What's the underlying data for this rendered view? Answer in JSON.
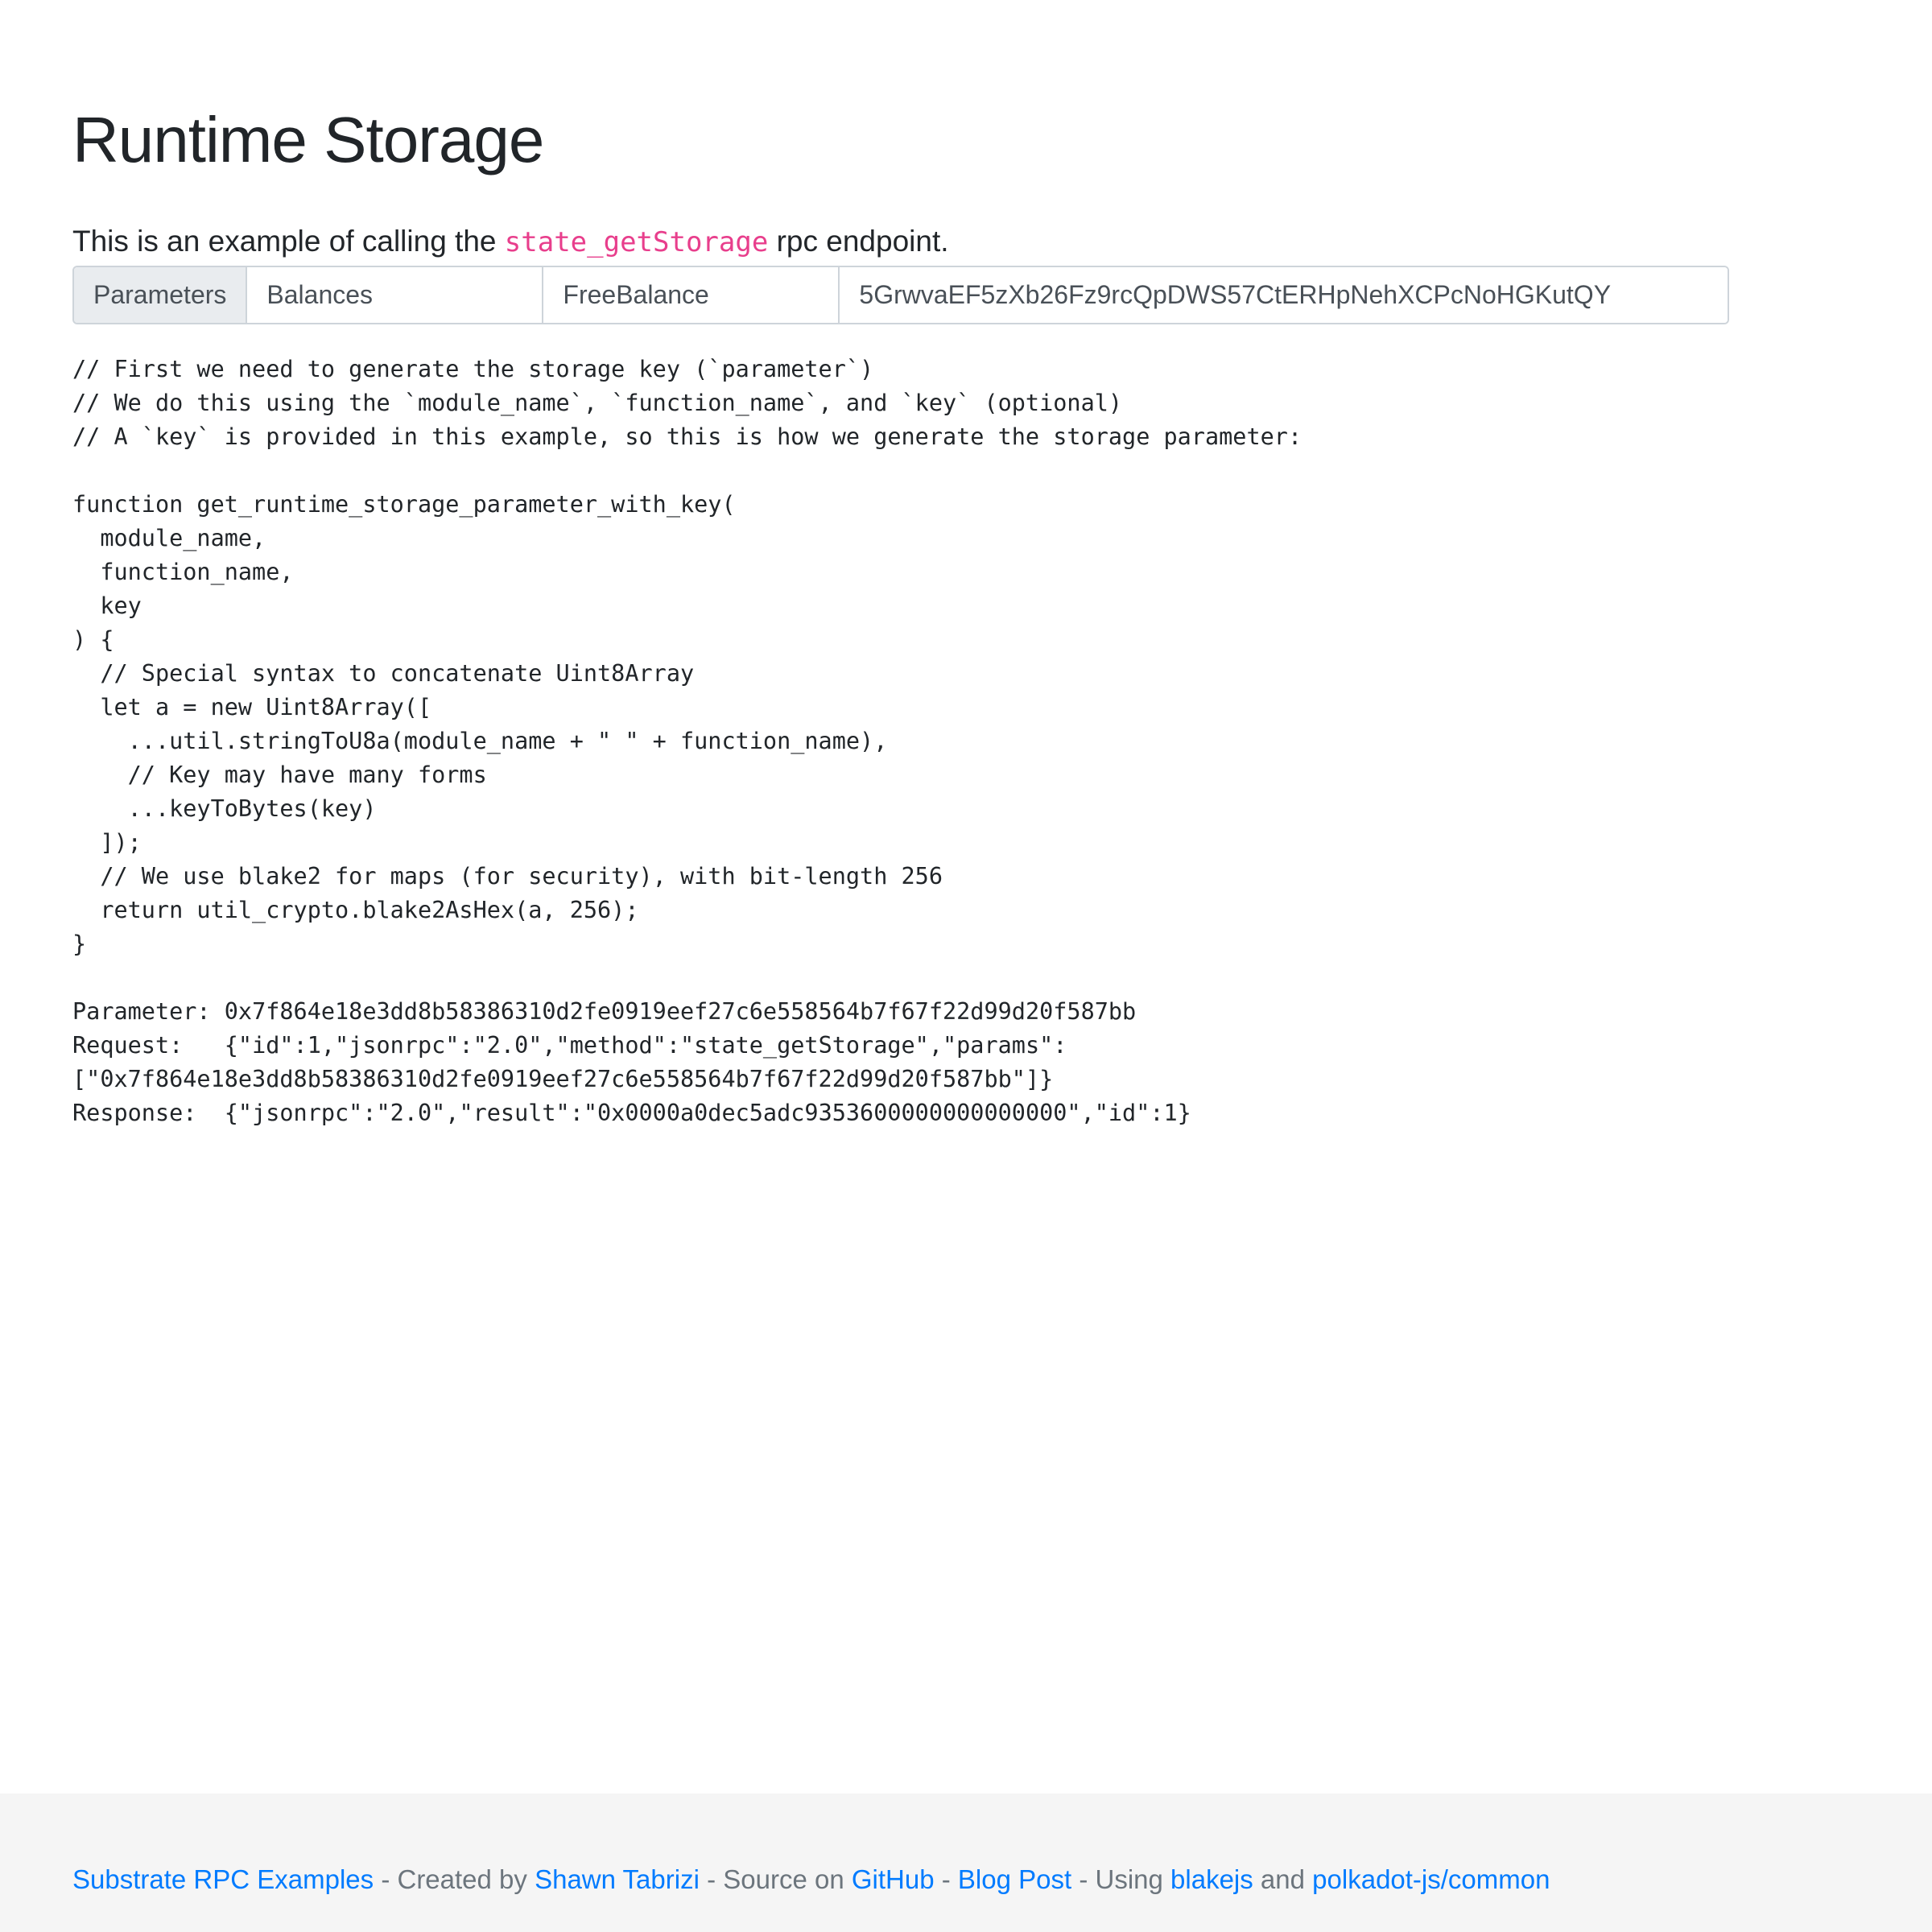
{
  "page": {
    "title": "Runtime Storage",
    "lead_prefix": "This is an example of calling the ",
    "lead_code": "state_getStorage",
    "lead_suffix": " rpc endpoint."
  },
  "parameters": {
    "label": "Parameters",
    "module_value": "Balances",
    "function_value": "FreeBalance",
    "key_value": "5GrwvaEF5zXb26Fz9rcQpDWS57CtERHpNehXCPcNoHGKutQY"
  },
  "code": {
    "lines": [
      "// First we need to generate the storage key (`parameter`)",
      "// We do this using the `module_name`, `function_name`, and `key` (optional)",
      "// A `key` is provided in this example, so this is how we generate the storage parameter:",
      "",
      "function get_runtime_storage_parameter_with_key(",
      "  module_name,",
      "  function_name,",
      "  key",
      ") {",
      "  // Special syntax to concatenate Uint8Array",
      "  let a = new Uint8Array([",
      "    ...util.stringToU8a(module_name + \" \" + function_name),",
      "    // Key may have many forms",
      "    ...keyToBytes(key)",
      "  ]);",
      "  // We use blake2 for maps (for security), with bit-length 256",
      "  return util_crypto.blake2AsHex(a, 256);",
      "}"
    ]
  },
  "output": {
    "parameter_label": "Parameter: ",
    "parameter_value": "0x7f864e18e3dd8b58386310d2fe0919eef27c6e558564b7f67f22d99d20f587bb",
    "request_label": "Request:   ",
    "request_value": "{\"id\":1,\"jsonrpc\":\"2.0\",\"method\":\"state_getStorage\",\"params\":\n[\"0x7f864e18e3dd8b58386310d2fe0919eef27c6e558564b7f67f22d99d20f587bb\"]}",
    "response_label": "Response:  ",
    "response_value": "{\"jsonrpc\":\"2.0\",\"result\":\"0x0000a0dec5adc9353600000000000000\",\"id\":1}"
  },
  "footer": {
    "link_examples": "Substrate RPC Examples",
    "sep1": " - Created by ",
    "link_author": "Shawn Tabrizi",
    "sep2": " - Source on ",
    "link_github": "GitHub",
    "sep3": " - ",
    "link_blog": "Blog Post",
    "sep4": " - Using ",
    "link_blakejs": "blakejs",
    "sep5": " and ",
    "link_polkadot": "polkadot-js/common"
  },
  "colors": {
    "link": "#007bff",
    "code_accent": "#e83e8c",
    "footer_bg": "#f5f5f5"
  }
}
